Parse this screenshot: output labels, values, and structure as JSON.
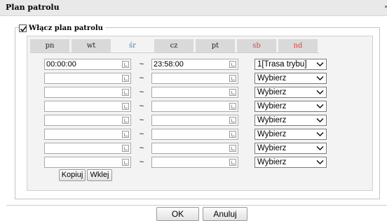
{
  "title": "Plan patrolu",
  "enable": {
    "label": "Włącz plan patrolu",
    "checked": true
  },
  "tabs": [
    {
      "label": "pn",
      "state": "normal"
    },
    {
      "label": "wt",
      "state": "normal"
    },
    {
      "label": "śr",
      "state": "active"
    },
    {
      "label": "cz",
      "state": "normal"
    },
    {
      "label": "pt",
      "state": "normal"
    },
    {
      "label": "sb",
      "state": "weekend"
    },
    {
      "label": "nd",
      "state": "weekend"
    }
  ],
  "separator": "~",
  "rows": [
    {
      "start": "00:00:00",
      "end": "23:58:00",
      "mode": "1[Trasa trybu]"
    },
    {
      "start": "",
      "end": "",
      "mode": "Wybierz"
    },
    {
      "start": "",
      "end": "",
      "mode": "Wybierz"
    },
    {
      "start": "",
      "end": "",
      "mode": "Wybierz"
    },
    {
      "start": "",
      "end": "",
      "mode": "Wybierz"
    },
    {
      "start": "",
      "end": "",
      "mode": "Wybierz"
    },
    {
      "start": "",
      "end": "",
      "mode": "Wybierz"
    },
    {
      "start": "",
      "end": "",
      "mode": "Wybierz"
    }
  ],
  "buttons": {
    "copy": "Kopiuj",
    "paste": "Wklej",
    "ok": "OK",
    "cancel": "Anuluj"
  },
  "colors": {
    "active_tab": "#3a86c8",
    "weekend_tab": "#d94040"
  }
}
